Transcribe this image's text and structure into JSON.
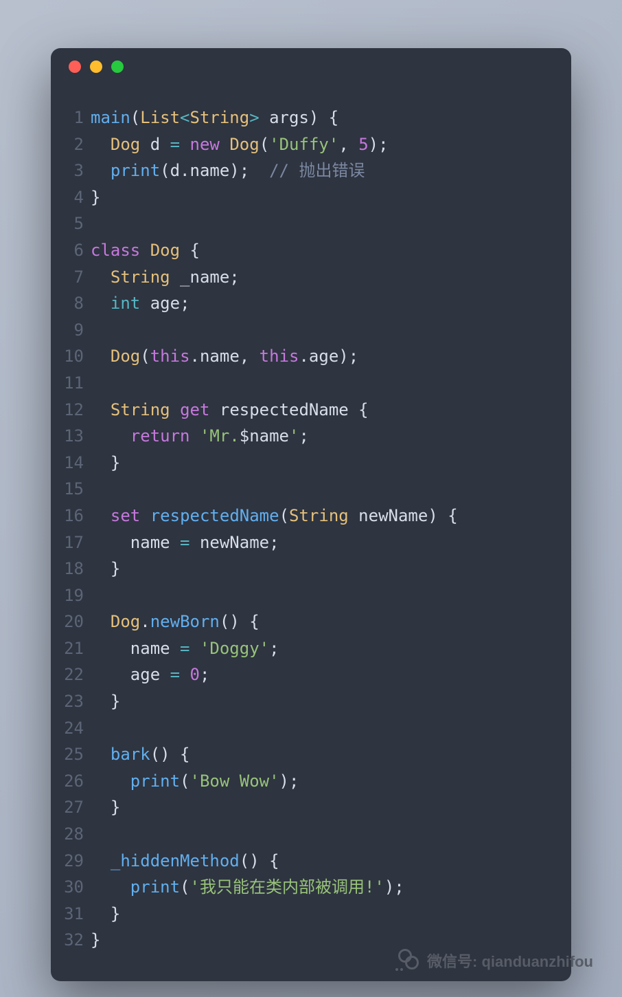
{
  "window": {
    "controls": [
      "close",
      "minimize",
      "zoom"
    ]
  },
  "code": {
    "lines": [
      {
        "n": 1,
        "tokens": [
          {
            "t": "main",
            "c": "t-func"
          },
          {
            "t": "(",
            "c": "t-punct"
          },
          {
            "t": "List",
            "c": "t-class"
          },
          {
            "t": "<",
            "c": "t-op"
          },
          {
            "t": "String",
            "c": "t-class"
          },
          {
            "t": ">",
            "c": "t-op"
          },
          {
            "t": " args",
            "c": "t-plain"
          },
          {
            "t": ")",
            "c": "t-punct"
          },
          {
            "t": " {",
            "c": "t-punct"
          }
        ]
      },
      {
        "n": 2,
        "tokens": [
          {
            "t": "  ",
            "c": "t-plain"
          },
          {
            "t": "Dog",
            "c": "t-class"
          },
          {
            "t": " d ",
            "c": "t-plain"
          },
          {
            "t": "=",
            "c": "t-op"
          },
          {
            "t": " ",
            "c": "t-plain"
          },
          {
            "t": "new",
            "c": "t-keyword"
          },
          {
            "t": " ",
            "c": "t-plain"
          },
          {
            "t": "Dog",
            "c": "t-class"
          },
          {
            "t": "(",
            "c": "t-punct"
          },
          {
            "t": "'Duffy'",
            "c": "t-string"
          },
          {
            "t": ", ",
            "c": "t-punct"
          },
          {
            "t": "5",
            "c": "t-number"
          },
          {
            "t": ");",
            "c": "t-punct"
          }
        ]
      },
      {
        "n": 3,
        "tokens": [
          {
            "t": "  ",
            "c": "t-plain"
          },
          {
            "t": "print",
            "c": "t-func"
          },
          {
            "t": "(d.name);  ",
            "c": "t-plain"
          },
          {
            "t": "// 抛出错误",
            "c": "t-comment"
          }
        ]
      },
      {
        "n": 4,
        "tokens": [
          {
            "t": "}",
            "c": "t-punct"
          }
        ]
      },
      {
        "n": 5,
        "tokens": [
          {
            "t": "",
            "c": "t-plain"
          }
        ]
      },
      {
        "n": 6,
        "tokens": [
          {
            "t": "class",
            "c": "t-keyword"
          },
          {
            "t": " ",
            "c": "t-plain"
          },
          {
            "t": "Dog",
            "c": "t-class"
          },
          {
            "t": " {",
            "c": "t-punct"
          }
        ]
      },
      {
        "n": 7,
        "tokens": [
          {
            "t": "  ",
            "c": "t-plain"
          },
          {
            "t": "String",
            "c": "t-class"
          },
          {
            "t": " _name;",
            "c": "t-plain"
          }
        ]
      },
      {
        "n": 8,
        "tokens": [
          {
            "t": "  ",
            "c": "t-plain"
          },
          {
            "t": "int",
            "c": "t-type"
          },
          {
            "t": " age;",
            "c": "t-plain"
          }
        ]
      },
      {
        "n": 9,
        "tokens": [
          {
            "t": "",
            "c": "t-plain"
          }
        ]
      },
      {
        "n": 10,
        "tokens": [
          {
            "t": "  ",
            "c": "t-plain"
          },
          {
            "t": "Dog",
            "c": "t-class"
          },
          {
            "t": "(",
            "c": "t-punct"
          },
          {
            "t": "this",
            "c": "t-keyword"
          },
          {
            "t": ".name, ",
            "c": "t-plain"
          },
          {
            "t": "this",
            "c": "t-keyword"
          },
          {
            "t": ".age);",
            "c": "t-plain"
          }
        ]
      },
      {
        "n": 11,
        "tokens": [
          {
            "t": "",
            "c": "t-plain"
          }
        ]
      },
      {
        "n": 12,
        "tokens": [
          {
            "t": "  ",
            "c": "t-plain"
          },
          {
            "t": "String",
            "c": "t-class"
          },
          {
            "t": " ",
            "c": "t-plain"
          },
          {
            "t": "get",
            "c": "t-keyword"
          },
          {
            "t": " respectedName {",
            "c": "t-plain"
          }
        ]
      },
      {
        "n": 13,
        "tokens": [
          {
            "t": "    ",
            "c": "t-plain"
          },
          {
            "t": "return",
            "c": "t-keyword"
          },
          {
            "t": " ",
            "c": "t-plain"
          },
          {
            "t": "'Mr.",
            "c": "t-string"
          },
          {
            "t": "$name",
            "c": "t-plain"
          },
          {
            "t": "'",
            "c": "t-string"
          },
          {
            "t": ";",
            "c": "t-punct"
          }
        ]
      },
      {
        "n": 14,
        "tokens": [
          {
            "t": "  }",
            "c": "t-punct"
          }
        ]
      },
      {
        "n": 15,
        "tokens": [
          {
            "t": "",
            "c": "t-plain"
          }
        ]
      },
      {
        "n": 16,
        "tokens": [
          {
            "t": "  ",
            "c": "t-plain"
          },
          {
            "t": "set",
            "c": "t-keyword"
          },
          {
            "t": " ",
            "c": "t-plain"
          },
          {
            "t": "respectedName",
            "c": "t-func"
          },
          {
            "t": "(",
            "c": "t-punct"
          },
          {
            "t": "String",
            "c": "t-class"
          },
          {
            "t": " newName) {",
            "c": "t-plain"
          }
        ]
      },
      {
        "n": 17,
        "tokens": [
          {
            "t": "    name ",
            "c": "t-plain"
          },
          {
            "t": "=",
            "c": "t-op"
          },
          {
            "t": " newName;",
            "c": "t-plain"
          }
        ]
      },
      {
        "n": 18,
        "tokens": [
          {
            "t": "  }",
            "c": "t-punct"
          }
        ]
      },
      {
        "n": 19,
        "tokens": [
          {
            "t": "",
            "c": "t-plain"
          }
        ]
      },
      {
        "n": 20,
        "tokens": [
          {
            "t": "  ",
            "c": "t-plain"
          },
          {
            "t": "Dog",
            "c": "t-class"
          },
          {
            "t": ".",
            "c": "t-punct"
          },
          {
            "t": "newBorn",
            "c": "t-func"
          },
          {
            "t": "() {",
            "c": "t-punct"
          }
        ]
      },
      {
        "n": 21,
        "tokens": [
          {
            "t": "    name ",
            "c": "t-plain"
          },
          {
            "t": "=",
            "c": "t-op"
          },
          {
            "t": " ",
            "c": "t-plain"
          },
          {
            "t": "'Doggy'",
            "c": "t-string"
          },
          {
            "t": ";",
            "c": "t-punct"
          }
        ]
      },
      {
        "n": 22,
        "tokens": [
          {
            "t": "    age ",
            "c": "t-plain"
          },
          {
            "t": "=",
            "c": "t-op"
          },
          {
            "t": " ",
            "c": "t-plain"
          },
          {
            "t": "0",
            "c": "t-number"
          },
          {
            "t": ";",
            "c": "t-punct"
          }
        ]
      },
      {
        "n": 23,
        "tokens": [
          {
            "t": "  }",
            "c": "t-punct"
          }
        ]
      },
      {
        "n": 24,
        "tokens": [
          {
            "t": "",
            "c": "t-plain"
          }
        ]
      },
      {
        "n": 25,
        "tokens": [
          {
            "t": "  ",
            "c": "t-plain"
          },
          {
            "t": "bark",
            "c": "t-func"
          },
          {
            "t": "() {",
            "c": "t-punct"
          }
        ]
      },
      {
        "n": 26,
        "tokens": [
          {
            "t": "    ",
            "c": "t-plain"
          },
          {
            "t": "print",
            "c": "t-func"
          },
          {
            "t": "(",
            "c": "t-punct"
          },
          {
            "t": "'Bow Wow'",
            "c": "t-string"
          },
          {
            "t": ");",
            "c": "t-punct"
          }
        ]
      },
      {
        "n": 27,
        "tokens": [
          {
            "t": "  }",
            "c": "t-punct"
          }
        ]
      },
      {
        "n": 28,
        "tokens": [
          {
            "t": "",
            "c": "t-plain"
          }
        ]
      },
      {
        "n": 29,
        "tokens": [
          {
            "t": "  ",
            "c": "t-plain"
          },
          {
            "t": "_hiddenMethod",
            "c": "t-func"
          },
          {
            "t": "() {",
            "c": "t-punct"
          }
        ]
      },
      {
        "n": 30,
        "tokens": [
          {
            "t": "    ",
            "c": "t-plain"
          },
          {
            "t": "print",
            "c": "t-func"
          },
          {
            "t": "(",
            "c": "t-punct"
          },
          {
            "t": "'我只能在类内部被调用!'",
            "c": "t-string"
          },
          {
            "t": ");",
            "c": "t-punct"
          }
        ]
      },
      {
        "n": 31,
        "tokens": [
          {
            "t": "  }",
            "c": "t-punct"
          }
        ]
      },
      {
        "n": 32,
        "tokens": [
          {
            "t": "}",
            "c": "t-punct"
          }
        ]
      }
    ]
  },
  "watermark": {
    "text": "微信号: qianduanzhifou"
  }
}
